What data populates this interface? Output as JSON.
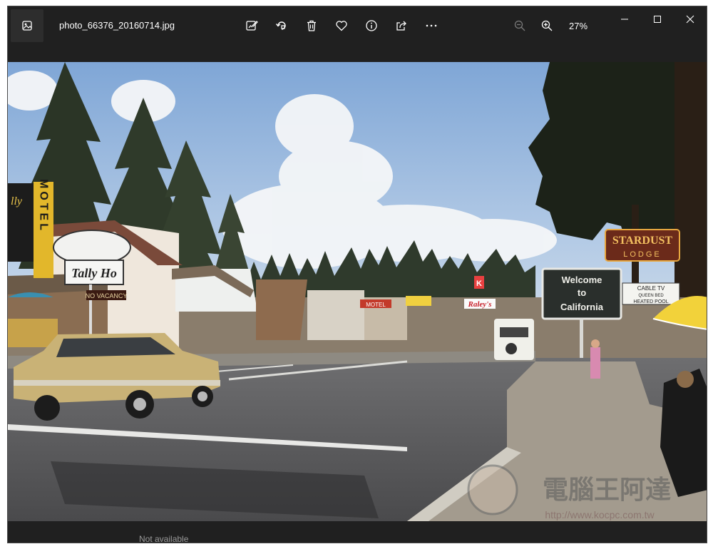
{
  "window": {
    "filename": "photo_66376_20160714.jpg"
  },
  "toolbar": {
    "items": [
      {
        "name": "edit-image-icon"
      },
      {
        "name": "rotate-icon"
      },
      {
        "name": "delete-icon"
      },
      {
        "name": "favorite-heart-icon"
      },
      {
        "name": "info-icon"
      },
      {
        "name": "share-icon"
      },
      {
        "name": "more-options-icon"
      }
    ]
  },
  "zoom": {
    "level": "27%"
  },
  "photo": {
    "signs": {
      "welcome_line1": "Welcome",
      "welcome_line2": "to",
      "welcome_line3": "California",
      "motel": "MOTEL",
      "tally_ho": "Tally Ho",
      "vacancy": "NO VACANCY",
      "stardust": "STARDUST",
      "lodge": "LODGE",
      "cable_tv": "CABLE TV",
      "queen_bed": "QUEEN BED",
      "heated_pool": "HEATED POOL",
      "raleys": "Raley's",
      "motel_small": "MOTEL",
      "kfc": "K",
      "watermark_cn": "電腦王阿達",
      "watermark_url": "http://www.kocpc.com.tw"
    }
  },
  "statusbar": {
    "text": "Not available"
  },
  "colors": {
    "chrome_bg": "#202020",
    "icon_fg": "#ffffff",
    "icon_disabled": "#7a7a7a"
  }
}
